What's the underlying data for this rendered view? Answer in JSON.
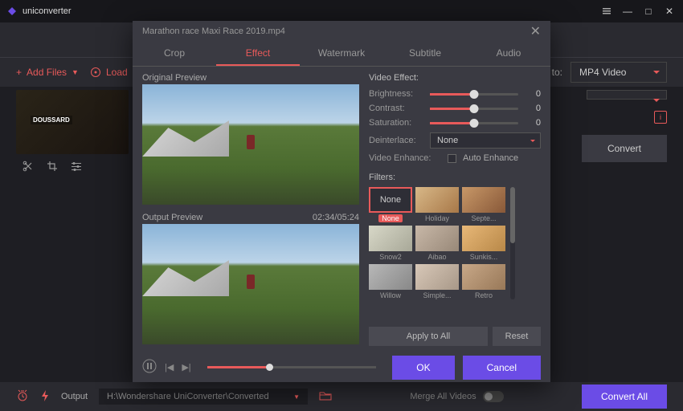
{
  "app": {
    "name": "uniconverter"
  },
  "window": {
    "minimize": "—",
    "maximize": "□",
    "close": "✕"
  },
  "toolbar": {
    "add_files": "Add Files",
    "load": "Load",
    "convert_to_label": "to:",
    "convert_to_value": "MP4 Video",
    "convert_btn": "Convert"
  },
  "thumb": {
    "label": "DOUSSARD"
  },
  "modal": {
    "filename": "Marathon race  Maxi Race 2019.mp4",
    "tabs": [
      "Crop",
      "Effect",
      "Watermark",
      "Subtitle",
      "Audio"
    ],
    "active_tab": "Effect",
    "original_preview": "Original Preview",
    "output_preview": "Output Preview",
    "time": "02:34/05:24",
    "video_effect": "Video Effect:",
    "brightness": {
      "label": "Brightness:",
      "value": "0"
    },
    "contrast": {
      "label": "Contrast:",
      "value": "0"
    },
    "saturation": {
      "label": "Saturation:",
      "value": "0"
    },
    "deinterlace": {
      "label": "Deinterlace:",
      "value": "None"
    },
    "enhance": {
      "label": "Video Enhance:",
      "checkbox": "Auto Enhance"
    },
    "filters_label": "Filters:",
    "filters": [
      "None",
      "Holiday",
      "Septe...",
      "Snow2",
      "Aibao",
      "Sunkis...",
      "Willow",
      "Simple...",
      "Retro"
    ],
    "apply_all": "Apply to All",
    "reset": "Reset",
    "ok": "OK",
    "cancel": "Cancel"
  },
  "footer": {
    "output_label": "Output",
    "output_path": "H:\\Wondershare UniConverter\\Converted",
    "merge": "Merge All Videos",
    "convert_all": "Convert All"
  }
}
